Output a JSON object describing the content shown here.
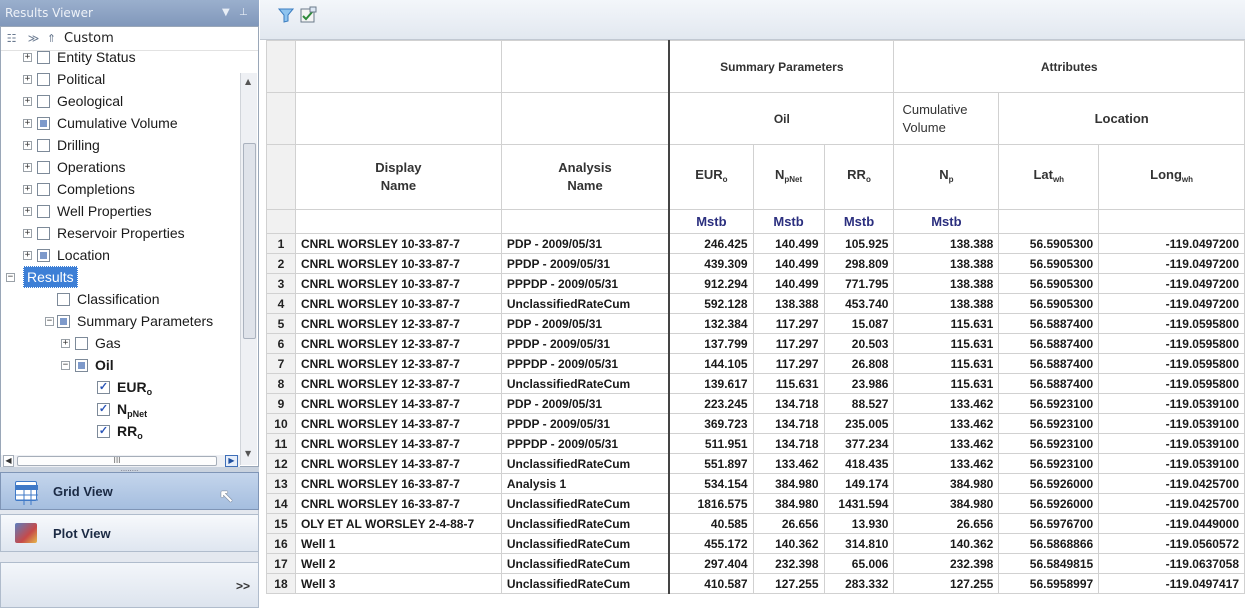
{
  "panel": {
    "title": "Results Viewer",
    "pin_glyph": "▾ ⅋",
    "view_mode": "Custom"
  },
  "tree": {
    "items": [
      {
        "label": "Entity Status",
        "expander": "+",
        "check": "empty"
      },
      {
        "label": "Political",
        "expander": "+",
        "check": "empty"
      },
      {
        "label": "Geological",
        "expander": "+",
        "check": "empty"
      },
      {
        "label": "Cumulative Volume",
        "expander": "+",
        "check": "partial"
      },
      {
        "label": "Drilling",
        "expander": "+",
        "check": "empty"
      },
      {
        "label": "Operations",
        "expander": "+",
        "check": "empty"
      },
      {
        "label": "Completions",
        "expander": "+",
        "check": "empty"
      },
      {
        "label": "Well Properties",
        "expander": "+",
        "check": "empty"
      },
      {
        "label": "Reservoir Properties",
        "expander": "+",
        "check": "empty"
      },
      {
        "label": "Location",
        "expander": "+",
        "check": "partial"
      },
      {
        "label": "Results",
        "expander": "−",
        "check": "none"
      },
      {
        "label": "Classification",
        "expander": "",
        "check": "empty"
      },
      {
        "label": "Summary Parameters",
        "expander": "−",
        "check": "partial"
      },
      {
        "label": "Gas",
        "expander": "+",
        "check": "empty"
      },
      {
        "label": "Oil",
        "expander": "−",
        "check": "partial"
      },
      {
        "label": "EUR",
        "sub": "o",
        "expander": "",
        "check": "checked"
      },
      {
        "label": "N",
        "sub": "pNet",
        "expander": "",
        "check": "checked"
      },
      {
        "label": "RR",
        "sub": "o",
        "expander": "",
        "check": "checked"
      }
    ]
  },
  "hscroll_grip": "III",
  "nav": {
    "grid_view": "Grid View",
    "plot_view": "Plot View",
    "more": ">>",
    "dots": "........"
  },
  "grid": {
    "group_summary": "Summary Parameters",
    "group_attributes": "Attributes",
    "sub_oil": "Oil",
    "sub_cumulative": "Cumulative Volume",
    "sub_location": "Location",
    "col_display": "Display Name",
    "col_analysis": "Analysis Name",
    "col_eur": "EUR",
    "col_eur_sub": "o",
    "col_npnet": "N",
    "col_npnet_sub": "pNet",
    "col_rr": "RR",
    "col_rr_sub": "o",
    "col_np": "N",
    "col_np_sub": "p",
    "col_lat": "Lat",
    "col_lat_sub": "wh",
    "col_long": "Long",
    "col_long_sub": "wh",
    "unit_eur": "Mstb",
    "unit_npnet": "Mstb",
    "unit_rr": "Mstb",
    "unit_np": "Mstb",
    "rows": [
      [
        "1",
        "CNRL WORSLEY 10-33-87-7",
        "PDP - 2009/05/31",
        "246.425",
        "140.499",
        "105.925",
        "138.388",
        "56.5905300",
        "-119.0497200"
      ],
      [
        "2",
        "CNRL WORSLEY 10-33-87-7",
        "PPDP - 2009/05/31",
        "439.309",
        "140.499",
        "298.809",
        "138.388",
        "56.5905300",
        "-119.0497200"
      ],
      [
        "3",
        "CNRL WORSLEY 10-33-87-7",
        "PPPDP - 2009/05/31",
        "912.294",
        "140.499",
        "771.795",
        "138.388",
        "56.5905300",
        "-119.0497200"
      ],
      [
        "4",
        "CNRL WORSLEY 10-33-87-7",
        "UnclassifiedRateCum",
        "592.128",
        "138.388",
        "453.740",
        "138.388",
        "56.5905300",
        "-119.0497200"
      ],
      [
        "5",
        "CNRL WORSLEY 12-33-87-7",
        "PDP - 2009/05/31",
        "132.384",
        "117.297",
        "15.087",
        "115.631",
        "56.5887400",
        "-119.0595800"
      ],
      [
        "6",
        "CNRL WORSLEY 12-33-87-7",
        "PPDP - 2009/05/31",
        "137.799",
        "117.297",
        "20.503",
        "115.631",
        "56.5887400",
        "-119.0595800"
      ],
      [
        "7",
        "CNRL WORSLEY 12-33-87-7",
        "PPPDP - 2009/05/31",
        "144.105",
        "117.297",
        "26.808",
        "115.631",
        "56.5887400",
        "-119.0595800"
      ],
      [
        "8",
        "CNRL WORSLEY 12-33-87-7",
        "UnclassifiedRateCum",
        "139.617",
        "115.631",
        "23.986",
        "115.631",
        "56.5887400",
        "-119.0595800"
      ],
      [
        "9",
        "CNRL WORSLEY 14-33-87-7",
        "PDP - 2009/05/31",
        "223.245",
        "134.718",
        "88.527",
        "133.462",
        "56.5923100",
        "-119.0539100"
      ],
      [
        "10",
        "CNRL WORSLEY 14-33-87-7",
        "PPDP - 2009/05/31",
        "369.723",
        "134.718",
        "235.005",
        "133.462",
        "56.5923100",
        "-119.0539100"
      ],
      [
        "11",
        "CNRL WORSLEY 14-33-87-7",
        "PPPDP - 2009/05/31",
        "511.951",
        "134.718",
        "377.234",
        "133.462",
        "56.5923100",
        "-119.0539100"
      ],
      [
        "12",
        "CNRL WORSLEY 14-33-87-7",
        "UnclassifiedRateCum",
        "551.897",
        "133.462",
        "418.435",
        "133.462",
        "56.5923100",
        "-119.0539100"
      ],
      [
        "13",
        "CNRL WORSLEY 16-33-87-7",
        "Analysis 1",
        "534.154",
        "384.980",
        "149.174",
        "384.980",
        "56.5926000",
        "-119.0425700"
      ],
      [
        "14",
        "CNRL WORSLEY 16-33-87-7",
        "UnclassifiedRateCum",
        "1816.575",
        "384.980",
        "1431.594",
        "384.980",
        "56.5926000",
        "-119.0425700"
      ],
      [
        "15",
        "OLY ET AL WORSLEY 2-4-88-7",
        "UnclassifiedRateCum",
        "40.585",
        "26.656",
        "13.930",
        "26.656",
        "56.5976700",
        "-119.0449000"
      ],
      [
        "16",
        "Well 1",
        "UnclassifiedRateCum",
        "455.172",
        "140.362",
        "314.810",
        "140.362",
        "56.5868866",
        "-119.0560572"
      ],
      [
        "17",
        "Well 2",
        "UnclassifiedRateCum",
        "297.404",
        "232.398",
        "65.006",
        "232.398",
        "56.5849815",
        "-119.0637058"
      ],
      [
        "18",
        "Well 3",
        "UnclassifiedRateCum",
        "410.587",
        "127.255",
        "283.332",
        "127.255",
        "56.5958997",
        "-119.0497417"
      ]
    ]
  },
  "colors": {
    "panel_title": "#8aa0c2",
    "selection": "#3d7fd6",
    "unit_text": "#2b2f7f",
    "grid_view_btn": "#b7cbe7"
  }
}
